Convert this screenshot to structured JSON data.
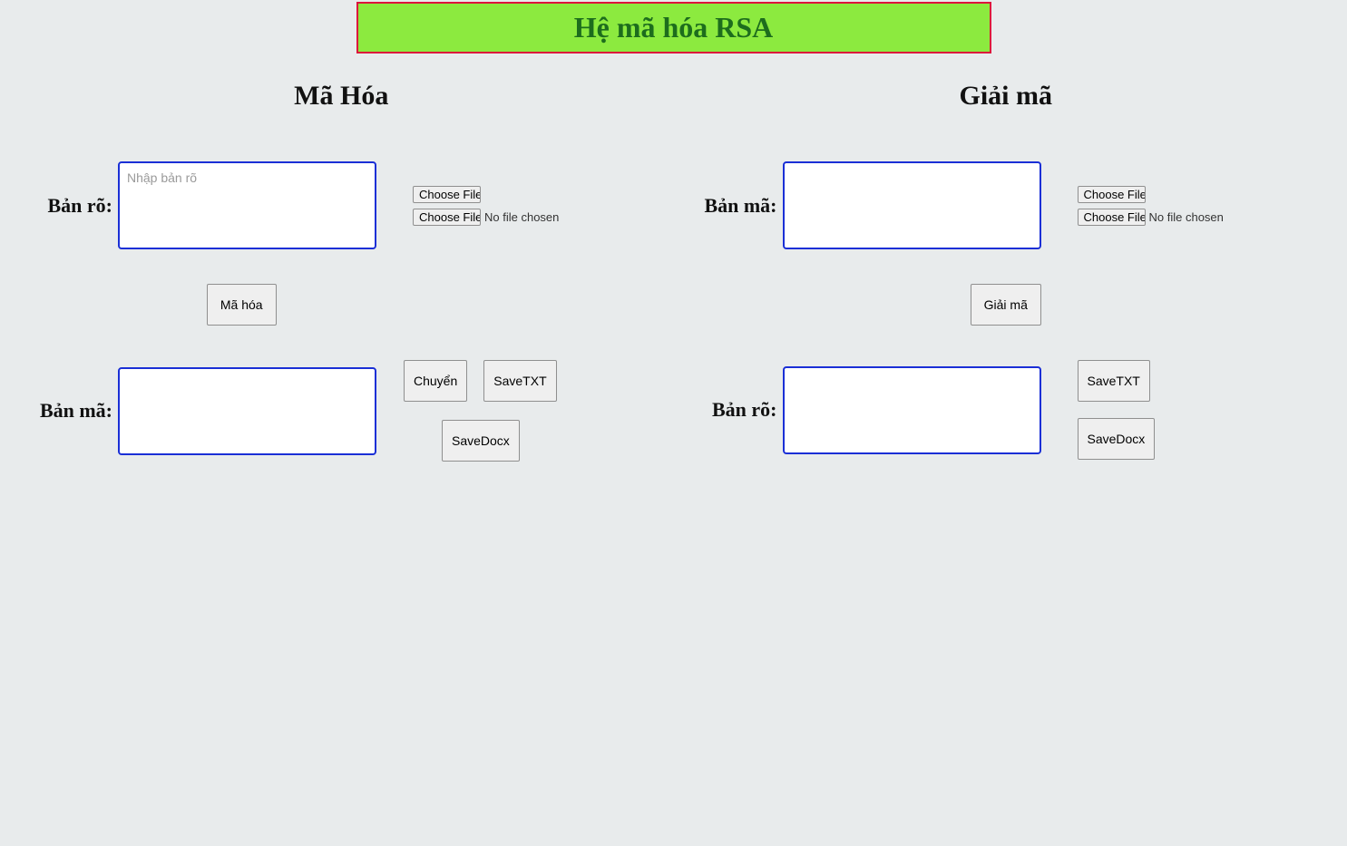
{
  "header": {
    "title": "Hệ mã hóa RSA"
  },
  "encrypt": {
    "title": "Mã Hóa",
    "plaintext_label": "Bản rõ:",
    "plaintext_placeholder": "Nhập bản rõ",
    "plaintext_value": "",
    "choose_file_label": "Choose File",
    "file_status": "No file chosen",
    "encrypt_button": "Mã hóa",
    "ciphertext_label": "Bản mã:",
    "ciphertext_value": "",
    "convert_button": "Chuyển",
    "save_txt_button": "SaveTXT",
    "save_docx_button": "SaveDocx"
  },
  "decrypt": {
    "title": "Giải mã",
    "ciphertext_label": "Bản mã:",
    "ciphertext_value": "",
    "choose_file_label": "Choose File",
    "file_status": "No file chosen",
    "decrypt_button": "Giải mã",
    "plaintext_label": "Bản rõ:",
    "plaintext_value": "",
    "save_txt_button": "SaveTXT",
    "save_docx_button": "SaveDocx"
  }
}
